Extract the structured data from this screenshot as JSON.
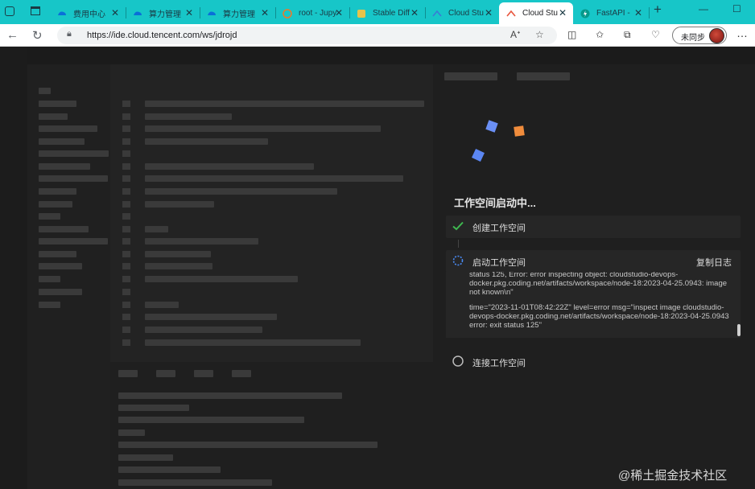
{
  "browser": {
    "tabs": [
      {
        "title": "费用中心",
        "active": false
      },
      {
        "title": "算力管理",
        "active": false
      },
      {
        "title": "算力管理",
        "active": false
      },
      {
        "title": "root - Jupy",
        "active": false
      },
      {
        "title": "Stable Diff",
        "active": false
      },
      {
        "title": "Cloud Stu",
        "active": false
      },
      {
        "title": "Cloud Stu",
        "active": true
      },
      {
        "title": "FastAPI -",
        "active": false
      }
    ],
    "new_tab": "+",
    "minimize": "—",
    "maximize": "☐",
    "url": "https://ide.cloud.tencent.com/ws/jdrojd",
    "sync_label": "未同步",
    "more": "…"
  },
  "workspace": {
    "title": "工作空间启动中...",
    "steps": [
      {
        "label": "创建工作空间",
        "status": "done"
      },
      {
        "label": "启动工作空间",
        "status": "running"
      },
      {
        "label": "连接工作空间",
        "status": "pending"
      }
    ],
    "copy_log_label": "复制日志",
    "log": {
      "line1": "status 125, Error: error inspecting object: cloudstudio-devops-docker.pkg.coding.net/artifacts/workspace/node-18:2023-04-25.0943: image not known\\n\"",
      "line2": "time=\"2023-11-01T08:42:22Z\" level=error msg=\"inspect image cloudstudio-devops-docker.pkg.coding.net/artifacts/workspace/node-18:2023-04-25.0943 error: exit status 125\""
    }
  },
  "watermark": "@稀土掘金技术社区",
  "colors": {
    "tab_strip": "#17c6c8",
    "check_green": "#3fb950",
    "logo_blue": "#6a8ff5",
    "logo_orange": "#f08c3c"
  }
}
